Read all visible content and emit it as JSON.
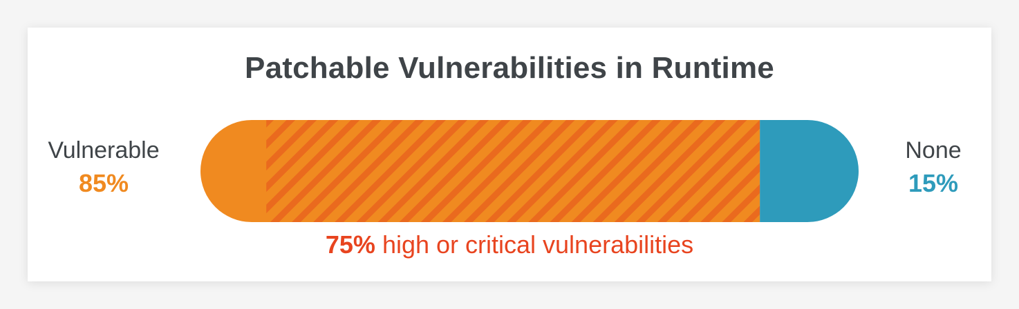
{
  "colors": {
    "vulnerable": "#f08a20",
    "stripe": "#ea6a1e",
    "none": "#2e9bbb",
    "caption": "#e8441f",
    "title": "#3f4448"
  },
  "chart_data": {
    "type": "bar",
    "title": "Patchable Vulnerabilities in Runtime",
    "orientation": "horizontal-stacked",
    "segments": [
      {
        "name": "Vulnerable",
        "label": "Vulnerable",
        "value": 85,
        "display": "85%"
      },
      {
        "name": "None",
        "label": "None",
        "value": 15,
        "display": "15%"
      }
    ],
    "sub_segment": {
      "value": 75,
      "display": "75%",
      "text": "high or critical vulnerabilities",
      "pattern": "striped"
    },
    "ylim": [
      0,
      100
    ]
  }
}
